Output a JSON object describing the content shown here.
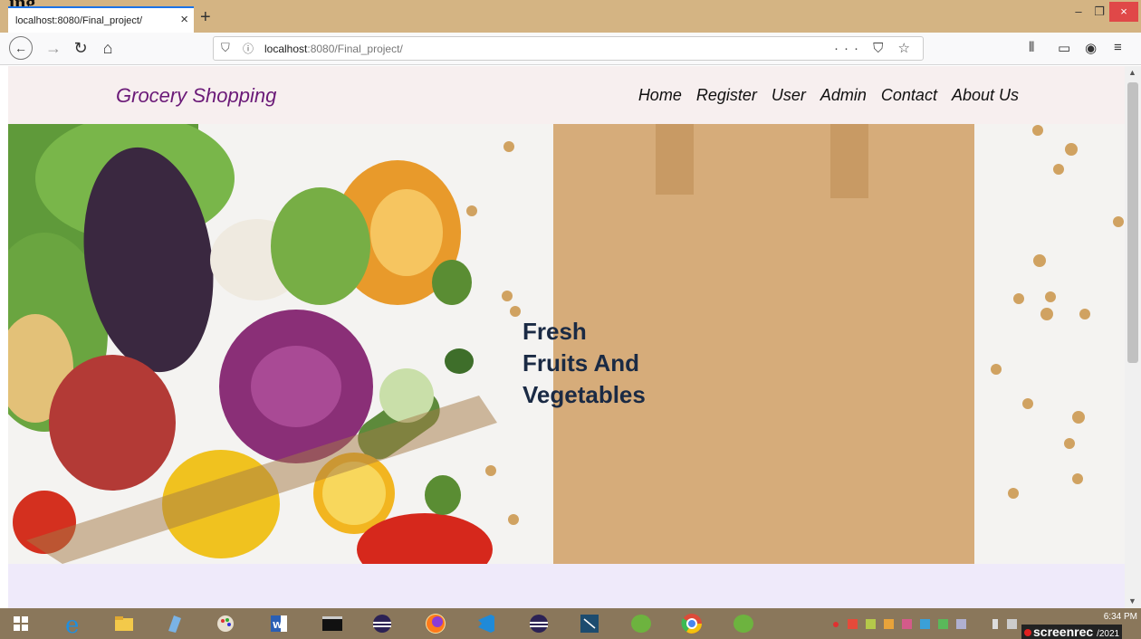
{
  "browser": {
    "page_heading_fragment": "ing",
    "tab_title": "localhost:8080/Final_project/",
    "tab_close": "×",
    "new_tab": "+",
    "url_host": "localhost",
    "url_rest": ":8080/Final_project/",
    "url_actions": "··· ⛉ ☆",
    "window_controls": {
      "minimize": "–",
      "maximize": "❐",
      "close": "×"
    }
  },
  "site": {
    "brand": "Grocery Shopping",
    "nav": [
      "Home",
      "Register",
      "User",
      "Admin",
      "Contact",
      "About Us"
    ],
    "hero_line1": "Fresh",
    "hero_line2": "Fruits And",
    "hero_line3": "Vegetables"
  },
  "taskbar": {
    "time": "6:34 PM",
    "date_fragment": "/2021",
    "recorder_label": "screenrec",
    "apps": [
      "windows-start",
      "internet-explorer",
      "file-explorer",
      "app-blue",
      "paint",
      "word",
      "terminal",
      "eclipse",
      "firefox",
      "vscode",
      "eclipse-2",
      "pycharm",
      "spring-tool",
      "chrome",
      "spring-tool-2"
    ]
  },
  "colors": {
    "tab_strip": "#d4b483",
    "brand": "#6b1a78",
    "hero_text": "#1a2a44",
    "header_bg": "#f7efef",
    "taskbar": "#8a775b"
  }
}
